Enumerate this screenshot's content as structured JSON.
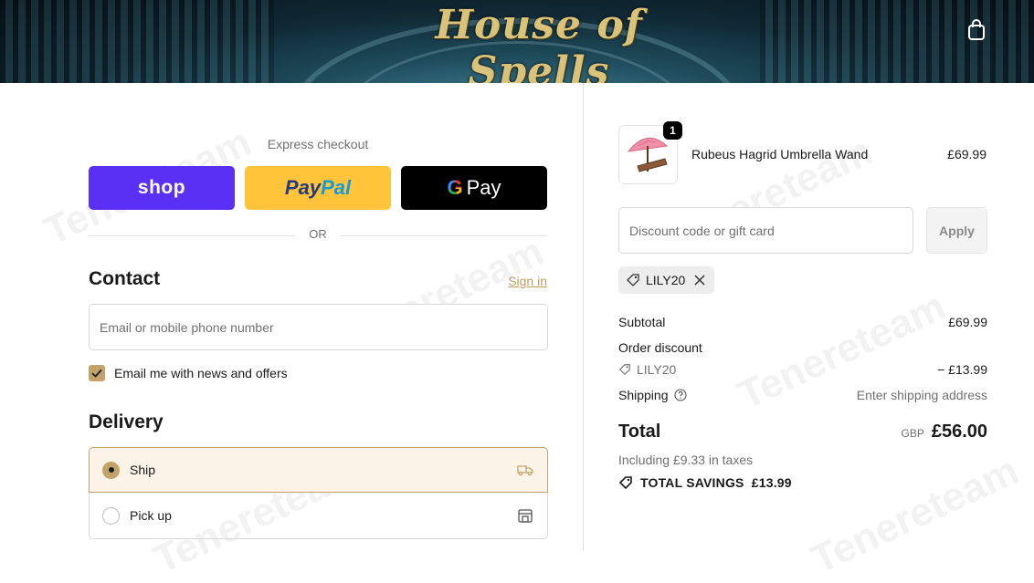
{
  "header": {
    "store_name": "House of Spells",
    "cart_icon": "shopping-bag-icon"
  },
  "express": {
    "label": "Express checkout",
    "shop_label": "shop",
    "paypal_part1": "Pay",
    "paypal_part2": "Pal",
    "gpay_g": "G",
    "gpay_label": "Pay",
    "or_label": "OR"
  },
  "contact": {
    "heading": "Contact",
    "sign_in": "Sign in",
    "email_placeholder": "Email or mobile phone number",
    "newsletter_label": "Email me with news and offers",
    "newsletter_checked": true
  },
  "delivery": {
    "heading": "Delivery",
    "options": [
      {
        "label": "Ship",
        "selected": true,
        "icon": "truck-icon"
      },
      {
        "label": "Pick up",
        "selected": false,
        "icon": "store-icon"
      }
    ]
  },
  "order": {
    "item": {
      "name": "Rubeus Hagrid Umbrella Wand",
      "price": "£69.99",
      "quantity": "1",
      "image_icon": "umbrella-wand-image"
    },
    "discount_placeholder": "Discount code or gift card",
    "apply_label": "Apply",
    "applied_code": "LILY20",
    "subtotal_label": "Subtotal",
    "subtotal_value": "£69.99",
    "order_discount_label": "Order discount",
    "discount_code": "LILY20",
    "discount_value": "− £13.99",
    "shipping_label": "Shipping",
    "shipping_value": "Enter shipping address",
    "total_label": "Total",
    "currency": "GBP",
    "total_value": "£56.00",
    "tax_note": "Including £9.33 in taxes",
    "savings": "TOTAL SAVINGS  £13.99"
  },
  "colors": {
    "accent": "#c4a36b",
    "shop_pay": "#5a31f4",
    "paypal": "#ffc439",
    "gpay": "#000000"
  }
}
